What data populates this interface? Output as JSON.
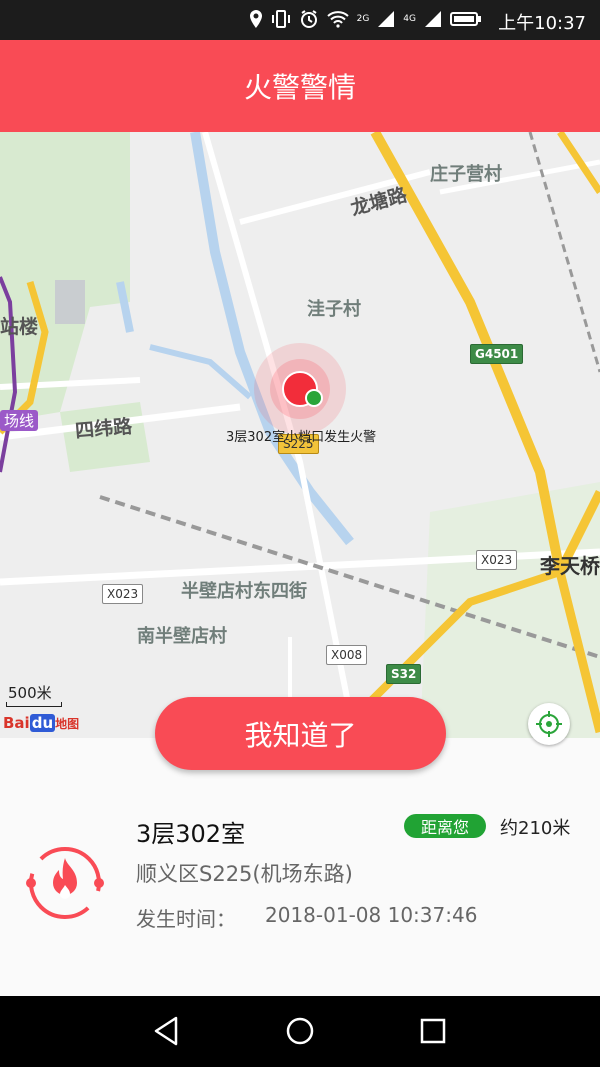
{
  "status_bar": {
    "time": "上午10:37",
    "network_a": "2G",
    "network_b": "4G"
  },
  "header": {
    "title": "火警警情"
  },
  "map": {
    "labels": {
      "zhuangziying": "庄子营村",
      "longtang_road": "龙塘路",
      "wazi": "洼子村",
      "station_building": "站楼",
      "siwei_road": "四纬路",
      "airport_line": "场线",
      "bandianzhan_east4": "半壁店村东四街",
      "nan_bandian": "南半壁店村",
      "litianqiao": "李天桥"
    },
    "shields": {
      "g4501": "G4501",
      "s225": "S225",
      "x023_left": "X023",
      "x023_right": "X023",
      "x008": "X008",
      "s32": "S32"
    },
    "alert_label": "3层302室小档口发生火警",
    "scale": "500米",
    "logo": {
      "bai": "Bai",
      "du": "du",
      "ditu": "地图"
    }
  },
  "actions": {
    "ack_label": "我知道了"
  },
  "detail": {
    "address_title": "3层302室",
    "distance_tag": "距离您",
    "distance": "约210米",
    "address_sub": "顺义区S225(机场东路)",
    "time_label": "发生时间：",
    "time_value": "2018-01-08 10:37:46"
  },
  "colors": {
    "accent": "#f94b55",
    "tag_green": "#21a334",
    "nav_bg": "#000000"
  },
  "icons": [
    "location-icon",
    "vibrate-icon",
    "alarm-icon",
    "wifi-icon",
    "signal-icon",
    "battery-icon",
    "fire-icon",
    "locate-icon",
    "back-icon",
    "home-icon",
    "recents-icon"
  ]
}
